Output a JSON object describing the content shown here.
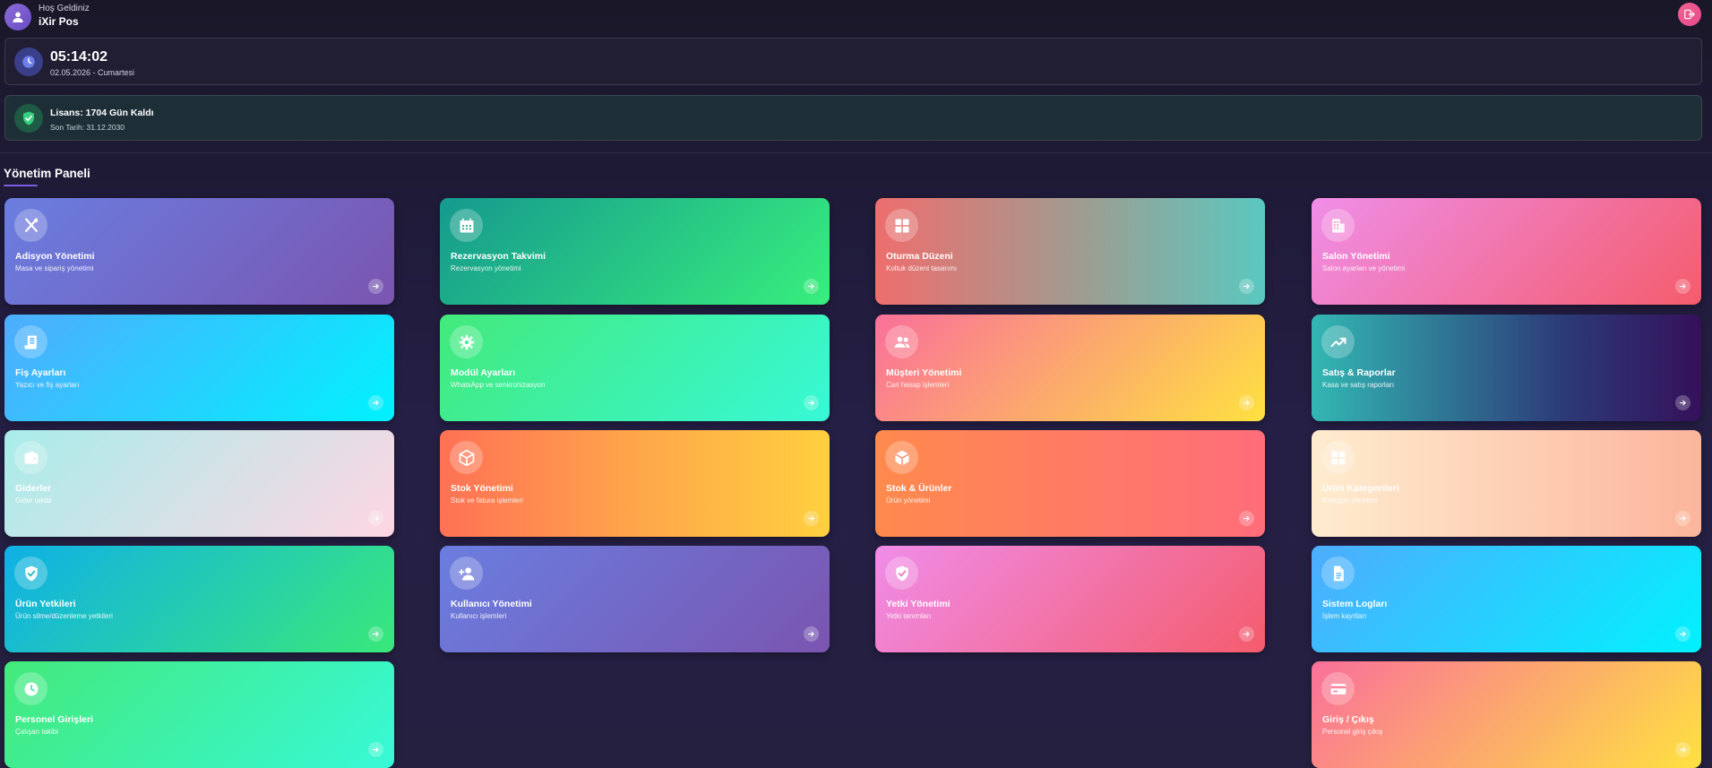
{
  "header": {
    "welcome": "Hoş Geldiniz",
    "user_name": "iXir Pos",
    "logout_icon": "logout-icon"
  },
  "clock": {
    "time": "05:14:02",
    "date": "02.05.2026 - Cumartesi"
  },
  "license": {
    "title": "Lisans: 1704 Gün Kaldı",
    "end_date": "Son Tarih: 31.12.2030"
  },
  "section": {
    "title": "Yönetim Paneli"
  },
  "cards": [
    {
      "title": "Adisyon Yönetimi",
      "subtitle": "Masa ve sipariş yönetimi",
      "icon": "utensils-icon"
    },
    {
      "title": "Rezervasyon Takvimi",
      "subtitle": "Rezervasyon yönetimi",
      "icon": "calendar-icon"
    },
    {
      "title": "Oturma Düzeni",
      "subtitle": "Koltuk düzeni tasarımı",
      "icon": "grid-icon"
    },
    {
      "title": "Salon Yönetimi",
      "subtitle": "Salon ayarları ve yönetimi",
      "icon": "building-icon"
    },
    {
      "title": "Fiş Ayarları",
      "subtitle": "Yazıcı ve fiş ayarları",
      "icon": "receipt-icon"
    },
    {
      "title": "Modül Ayarları",
      "subtitle": "WhatsApp ve senkronizasyon",
      "icon": "gear-icon"
    },
    {
      "title": "Müşteri Yönetimi",
      "subtitle": "Cari hesap işlemleri",
      "icon": "users-icon"
    },
    {
      "title": "Satış & Raporlar",
      "subtitle": "Kasa ve satış raporları",
      "icon": "chart-line-icon"
    },
    {
      "title": "Giderler",
      "subtitle": "Gider takibi",
      "icon": "wallet-icon"
    },
    {
      "title": "Stok Yönetimi",
      "subtitle": "Stok ve fatura işlemleri",
      "icon": "box-icon"
    },
    {
      "title": "Stok & Ürünler",
      "subtitle": "Ürün yönetimi",
      "icon": "box-icon"
    },
    {
      "title": "Ürün Kategorileri",
      "subtitle": "Kategori yönetimi",
      "icon": "grid-icon"
    },
    {
      "title": "Ürün Yetkileri",
      "subtitle": "Ürün silme/düzenleme yetkileri",
      "icon": "shield-check-icon"
    },
    {
      "title": "Kullanıcı Yönetimi",
      "subtitle": "Kullanıcı işlemleri",
      "icon": "user-plus-icon"
    },
    {
      "title": "Yetki Yönetimi",
      "subtitle": "Yetki tanımları",
      "icon": "shield-check-icon"
    },
    {
      "title": "Sistem Logları",
      "subtitle": "İşlem kayıtları",
      "icon": "document-icon"
    },
    {
      "title": "Personel Girişleri",
      "subtitle": "Çalışan takibi",
      "icon": "clock-icon"
    },
    {
      "title": "Giriş / Çıkış",
      "subtitle": "Personel giriş çıkış",
      "icon": "card-icon"
    }
  ],
  "colors": {
    "background": "#1f1a36",
    "accent": "#7a5fe0",
    "logout": "#e84a8a"
  }
}
